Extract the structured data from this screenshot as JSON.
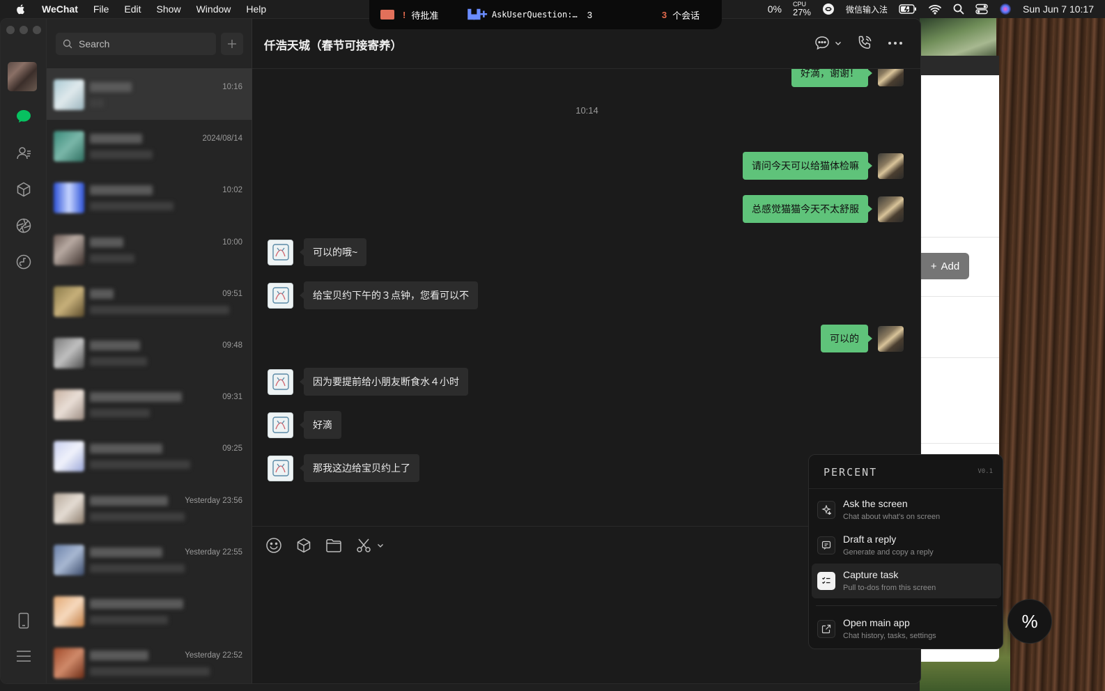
{
  "menubar": {
    "app_name": "WeChat",
    "menus": [
      "File",
      "Edit",
      "Show",
      "Window",
      "Help"
    ],
    "notch": {
      "pending_label": "待批准",
      "agent_text": "AskUserQuestion:…",
      "agent_count": "3",
      "session_count": "3",
      "session_label": "个会话"
    },
    "battery_text": "0%",
    "cpu_label": "CPU",
    "cpu_value": "27%",
    "input_method": "微信输入法",
    "clock": "Sun Jun 7  10:17"
  },
  "sidebar": {
    "search_placeholder": "Search"
  },
  "chat_list": [
    {
      "time": "10:16",
      "active": true
    },
    {
      "time": "2024/08/14"
    },
    {
      "time": "10:02"
    },
    {
      "time": "10:00"
    },
    {
      "time": "09:51"
    },
    {
      "time": "09:48"
    },
    {
      "time": "09:31"
    },
    {
      "time": "09:25"
    },
    {
      "time": "Yesterday 23:56"
    },
    {
      "time": "Yesterday 22:55"
    },
    {
      "time": ""
    },
    {
      "time": "Yesterday 22:52"
    }
  ],
  "conversation": {
    "title": "仟浩天城（春节可接寄养）",
    "timestamp": "10:14",
    "messages": [
      {
        "dir": "out",
        "text": "好滴，谢谢！"
      },
      {
        "dir": "out",
        "text": "请问今天可以给猫体检嘛"
      },
      {
        "dir": "out",
        "text": "总感觉猫猫今天不太舒服"
      },
      {
        "dir": "in",
        "text": "可以的哦~"
      },
      {
        "dir": "in",
        "text": "给宝贝约下午的３点钟，您看可以不"
      },
      {
        "dir": "out",
        "text": "可以的"
      },
      {
        "dir": "in",
        "text": "因为要提前给小朋友断食水４小时"
      },
      {
        "dir": "in",
        "text": "好滴"
      },
      {
        "dir": "in",
        "text": "那我这边给宝贝约上了"
      }
    ]
  },
  "background_window": {
    "add_label": "Add"
  },
  "percent_panel": {
    "title": "PERCENT",
    "version": "V0.1",
    "items": [
      {
        "label": "Ask the screen",
        "sub": "Chat about what's on screen",
        "icon": "sparkle-icon"
      },
      {
        "label": "Draft a reply",
        "sub": "Generate and copy a reply",
        "icon": "reply-icon"
      },
      {
        "label": "Capture task",
        "sub": "Pull to-dos from this screen",
        "icon": "checklist-icon"
      },
      {
        "label": "Open main app",
        "sub": "Chat history, tasks, settings",
        "icon": "external-link-icon"
      }
    ],
    "fab_label": "%"
  },
  "colors": {
    "outgoing_bubble": "#5fc37a",
    "incoming_bubble": "#2c2c2c",
    "accent_green": "#07c160"
  }
}
